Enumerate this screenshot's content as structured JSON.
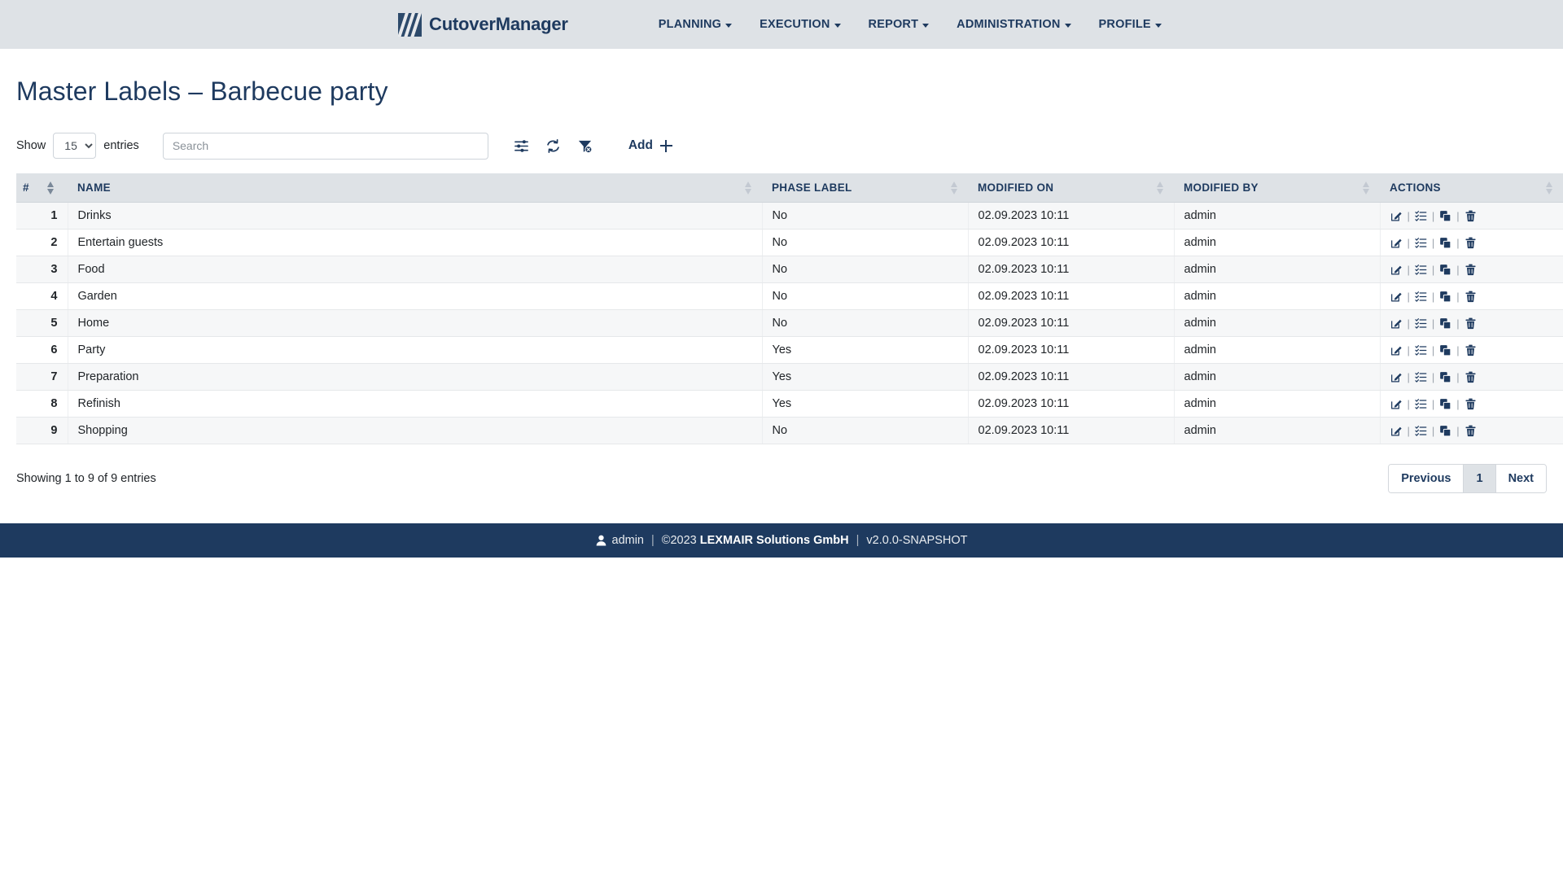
{
  "navbar": {
    "brand": "CutoverManager",
    "brand_mark": "three-slashes-logo",
    "items": [
      {
        "label": "PLANNING",
        "has_caret": true
      },
      {
        "label": "EXECUTION",
        "has_caret": true
      },
      {
        "label": "REPORT",
        "has_caret": true
      },
      {
        "label": "ADMINISTRATION",
        "has_caret": true
      },
      {
        "label": "PROFILE",
        "has_caret": true
      }
    ]
  },
  "page": {
    "title_main": "Master Labels",
    "title_sep": "–",
    "title_context": "Barbecue party"
  },
  "controls": {
    "show_label": "Show",
    "entries_label": "entries",
    "page_length_value": "15",
    "page_length_options": [
      "15"
    ],
    "search_placeholder": "Search",
    "search_value": "",
    "icons": [
      {
        "name": "column-settings-icon",
        "title": "column settings"
      },
      {
        "name": "refresh-icon",
        "title": "refresh"
      },
      {
        "name": "clear-filter-icon",
        "title": "clear filter"
      }
    ],
    "add_label": "Add"
  },
  "table": {
    "columns": [
      {
        "key": "num",
        "label": "#",
        "sorted": true,
        "dir": "asc"
      },
      {
        "key": "name",
        "label": "NAME",
        "sorted": false
      },
      {
        "key": "phase",
        "label": "PHASE LABEL",
        "sorted": false
      },
      {
        "key": "modon",
        "label": "MODIFIED ON",
        "sorted": false
      },
      {
        "key": "modby",
        "label": "MODIFIED BY",
        "sorted": false
      },
      {
        "key": "act",
        "label": "ACTIONS",
        "sorted": false
      }
    ],
    "action_icons": [
      "edit-icon",
      "checklist-icon",
      "copy-icon",
      "delete-icon"
    ],
    "action_separator": "|",
    "rows": [
      {
        "num": "1",
        "name": "Drinks",
        "phase": "No",
        "modon": "02.09.2023 10:11",
        "modby": "admin"
      },
      {
        "num": "2",
        "name": "Entertain guests",
        "phase": "No",
        "modon": "02.09.2023 10:11",
        "modby": "admin"
      },
      {
        "num": "3",
        "name": "Food",
        "phase": "No",
        "modon": "02.09.2023 10:11",
        "modby": "admin"
      },
      {
        "num": "4",
        "name": "Garden",
        "phase": "No",
        "modon": "02.09.2023 10:11",
        "modby": "admin"
      },
      {
        "num": "5",
        "name": "Home",
        "phase": "No",
        "modon": "02.09.2023 10:11",
        "modby": "admin"
      },
      {
        "num": "6",
        "name": "Party",
        "phase": "Yes",
        "modon": "02.09.2023 10:11",
        "modby": "admin"
      },
      {
        "num": "7",
        "name": "Preparation",
        "phase": "Yes",
        "modon": "02.09.2023 10:11",
        "modby": "admin"
      },
      {
        "num": "8",
        "name": "Refinish",
        "phase": "Yes",
        "modon": "02.09.2023 10:11",
        "modby": "admin"
      },
      {
        "num": "9",
        "name": "Shopping",
        "phase": "No",
        "modon": "02.09.2023 10:11",
        "modby": "admin"
      }
    ]
  },
  "table_footer": {
    "showing_info": "Showing 1 to 9 of 9 entries",
    "pagination": {
      "previous": "Previous",
      "pages": [
        "1"
      ],
      "active_page": "1",
      "next": "Next"
    }
  },
  "footer_bar": {
    "user_icon": "person-icon",
    "user": "admin",
    "sep1": "|",
    "copyright": "©2023",
    "company": "LEXMAIR Solutions GmbH",
    "sep2": "|",
    "version": "v2.0.0-SNAPSHOT"
  },
  "colors": {
    "navy": "#1e3a5f",
    "header_bg": "#dee2e6",
    "row_stripe": "#f6f7f8",
    "footer_bg": "#1e3a5f"
  }
}
